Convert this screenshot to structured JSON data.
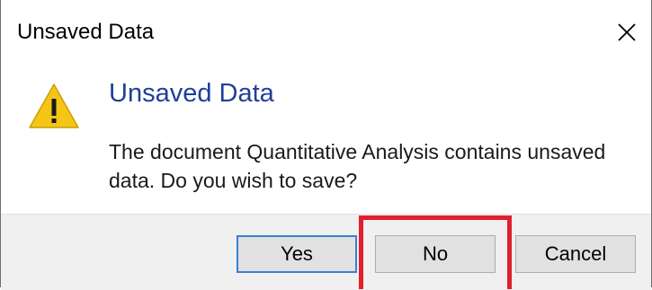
{
  "window": {
    "title": "Unsaved Data"
  },
  "dialog": {
    "heading": "Unsaved Data",
    "message": "The document Quantitative Analysis contains unsaved data.  Do you wish to save?",
    "icon": "warning-icon"
  },
  "buttons": {
    "yes_label": "Yes",
    "no_label": "No",
    "cancel_label": "Cancel"
  },
  "colors": {
    "heading": "#1f3f99",
    "default_button_border": "#3b7fd1",
    "highlight": "#e0202c",
    "warning_fill": "#f5c518"
  }
}
